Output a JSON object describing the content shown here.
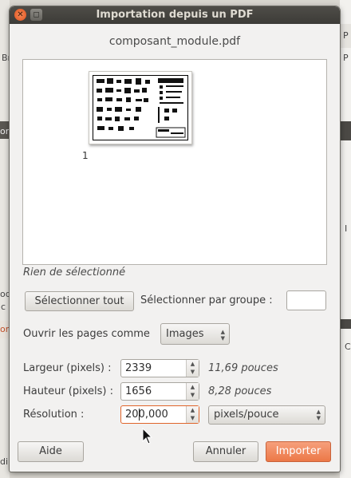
{
  "dialog": {
    "title": "Importation depuis un PDF",
    "filename": "composant_module.pdf"
  },
  "preview": {
    "pages": [
      {
        "number": "1"
      }
    ],
    "selection_status": "Rien de sélectionné"
  },
  "selection": {
    "select_all_label": "Sélectionner tout",
    "select_group_label": "Sélectionner par groupe :",
    "select_group_value": ""
  },
  "open_as": {
    "label": "Ouvrir les pages comme",
    "value": "Images"
  },
  "size": {
    "width_label": "Largeur (pixels) :",
    "width_value": "2339",
    "width_unit": "11,69 pouces",
    "height_label": "Hauteur (pixels) :",
    "height_value": "1656",
    "height_unit": "8,28 pouces",
    "resolution_label": "Résolution :",
    "resolution_value": "200,000",
    "resolution_unit": "pixels/pouce"
  },
  "buttons": {
    "help": "Aide",
    "cancel": "Annuler",
    "import": "Importer"
  },
  "window_controls": {
    "close_glyph": "✕",
    "maximize_glyph": "◻"
  },
  "background": {
    "left_texts": [
      "Br",
      "or",
      "od",
      "c",
      "or",
      "di"
    ],
    "right_texts": [
      "P",
      "P",
      "I",
      "C"
    ]
  },
  "colors": {
    "titlebar": "#3c3b37",
    "accent": "#ec7847",
    "focus": "#e0642a"
  }
}
